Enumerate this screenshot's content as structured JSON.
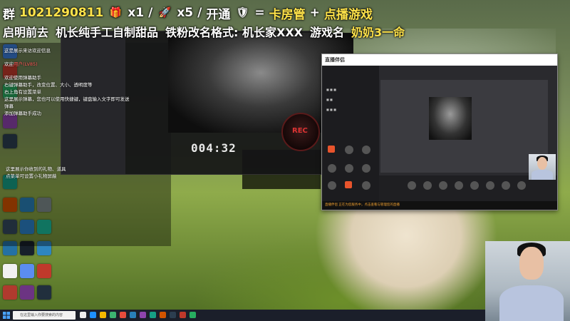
{
  "banner": {
    "line1": {
      "group_prefix": "群",
      "group_number": "1021290811",
      "gift1_count": "x1",
      "separator": "/",
      "gift2_count": "x5",
      "join_label": "开通",
      "equals": "=",
      "reward1": "卡房管",
      "plus": "+",
      "reward2": "点播游戏"
    },
    "line2": {
      "items": [
        "启明前去",
        "机长纯手工自制甜品",
        "铁粉改名格式: 机长家XXX",
        "游戏名",
        "奶奶3一命"
      ]
    }
  },
  "notice": {
    "lines": [
      "这是展示来访欢迎信息",
      "欢迎用户(LV85)用户(YG)进入直播间",
      "欢迎使用弹幕助手",
      "右键弹幕助手，改变位置、大小、透明度等",
      "右上角有设置菜单",
      "这里展示弹幕，您也可以使用快捷键，键盘输入文字即可发送弹幕",
      "添加弹幕助手成功"
    ],
    "highlight": "用户(LV85)",
    "bottom_lines": [
      "这里展示你收到的礼物、道具",
      "点菜单可设置小礼物屏蔽"
    ]
  },
  "recorder": {
    "timer": "004:32",
    "rec_label": "REC"
  },
  "live_window": {
    "logo": "直播伴侣",
    "warning": "直播伴侣 正在为您服务中，点击查看与管理您的直播"
  },
  "taskbar": {
    "search_placeholder": "在这里输入你要搜索的内容"
  },
  "colors": {
    "highlight": "#ffe34a",
    "notice_red": "#ff5a5a",
    "accent_orange": "#e8542c"
  }
}
